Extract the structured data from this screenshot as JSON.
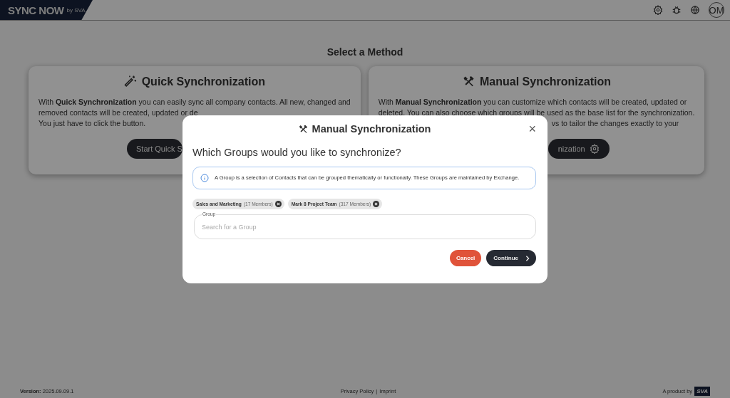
{
  "header": {
    "logo": {
      "name": "SYNC NOW",
      "by": "by SVA"
    },
    "avatar": "OM"
  },
  "page_title": "Select a Method",
  "cards": [
    {
      "kind": "quick",
      "title": "Quick Synchronization",
      "lines": [
        "With **Quick Synchronization** you can easily sync all company contacts. All new, changed and",
        "removed contacts will be created, updated or de",
        "You just have to click the button."
      ],
      "button": "Start Quick S"
    },
    {
      "kind": "manual",
      "title": "Manual Synchronization",
      "lines": [
        "With **Manual Synchronization** you can customize which contacts will be created, updated or",
        "deleted. You can also choose which groups will be used as the base list for the synchronization.",
        "vs to tailor the changes exactly to your"
      ],
      "button": "nization"
    }
  ],
  "dialog": {
    "title": "Manual Synchronization",
    "close": "×",
    "question": "Which Groups would you like to synchronize?",
    "info": "A Group is a selection of Contacts that can be grouped thematically or functionally. These Groups are maintained by Exchange.",
    "chips": [
      {
        "name": "Sales and Marketing",
        "count": "(17 Members)"
      },
      {
        "name": "Mark 8 Project Team",
        "count": "(317 Members)"
      }
    ],
    "field": {
      "label": "Group",
      "placeholder": "Search for a Group"
    },
    "buttons": [
      {
        "kind": "cancel",
        "label": "Cancel"
      },
      {
        "kind": "continue",
        "label": "Continue"
      }
    ]
  },
  "footer": {
    "version": "**Version:** 2025.09.09.1",
    "links": [
      "Privacy Policy",
      "Imprint"
    ],
    "separator": "|",
    "product": "A product by",
    "product_logo": "SVA"
  }
}
